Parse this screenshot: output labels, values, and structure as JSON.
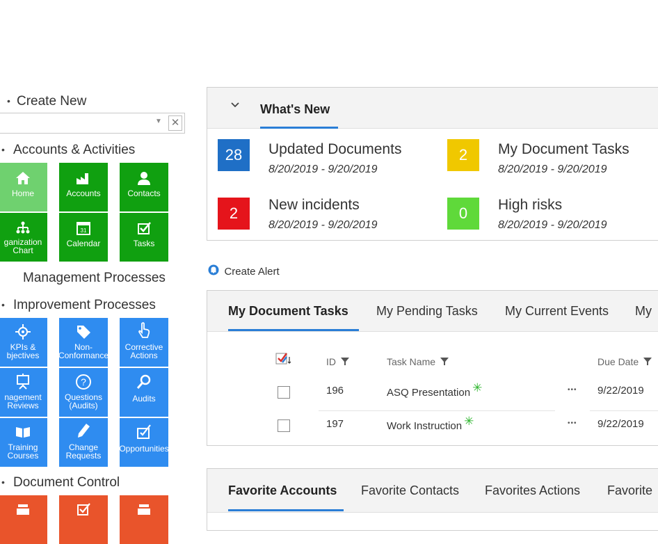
{
  "nav": {
    "create_new": "Create New",
    "search_placeholder": "",
    "clear_button": "✕",
    "sections": {
      "accounts": "Accounts & Activities",
      "management": "Management Processes",
      "improvement": "Improvement Processes",
      "document": "Document Control"
    },
    "tiles": {
      "home": "Home",
      "accounts": "Accounts",
      "contacts": "Contacts",
      "org_chart_1": "ganization",
      "org_chart_2": "Chart",
      "calendar": "Calendar",
      "calendar_day": "31",
      "tasks": "Tasks",
      "kpis_1": "KPIs &",
      "kpis_2": "bjectives",
      "nonconf_1": "Non-",
      "nonconf_2": "Conformance",
      "corrective_1": "Corrective",
      "corrective_2": "Actions",
      "mgmt_1": "nagement",
      "mgmt_2": "Reviews",
      "questions_1": "Questions",
      "questions_2": "(Audits)",
      "audits": "Audits",
      "training_1": "Training",
      "training_2": "Courses",
      "change_1": "Change",
      "change_2": "Requests",
      "opportunities": "Opportunities"
    },
    "colors": {
      "green": "#10a010",
      "light_green": "#6fd16f",
      "blue": "#2f8cf0",
      "orange": "#e9542b"
    }
  },
  "whats_new": {
    "chevron": "⌄",
    "title": "What's New",
    "items": [
      {
        "count": "28",
        "label": "Updated Documents",
        "dates": "8/20/2019 - 9/20/2019",
        "color": "#1f6fc6"
      },
      {
        "count": "2",
        "label": "My Document Tasks",
        "dates": "8/20/2019 - 9/20/2019",
        "color": "#f0c800"
      },
      {
        "count": "2",
        "label": "New incidents",
        "dates": "8/20/2019 - 9/20/2019",
        "color": "#e5141b"
      },
      {
        "count": "0",
        "label": "High risks",
        "dates": "8/20/2019 - 9/20/2019",
        "color": "#5fd93a"
      }
    ]
  },
  "alert": {
    "label": "Create Alert"
  },
  "tasks_panel": {
    "tabs": [
      "My Document Tasks",
      "My Pending Tasks",
      "My Current Events",
      "My"
    ],
    "columns": {
      "id": "ID",
      "name": "Task Name",
      "due": "Due Date"
    },
    "rows": [
      {
        "id": "196",
        "name": "ASQ Presentation",
        "due": "9/22/2019"
      },
      {
        "id": "197",
        "name": "Work Instruction",
        "due": "9/22/2019"
      }
    ],
    "new_marker": "✳",
    "more": "•••"
  },
  "favorites_panel": {
    "tabs": [
      "Favorite Accounts",
      "Favorite Contacts",
      "Favorites Actions",
      "Favorite"
    ]
  }
}
